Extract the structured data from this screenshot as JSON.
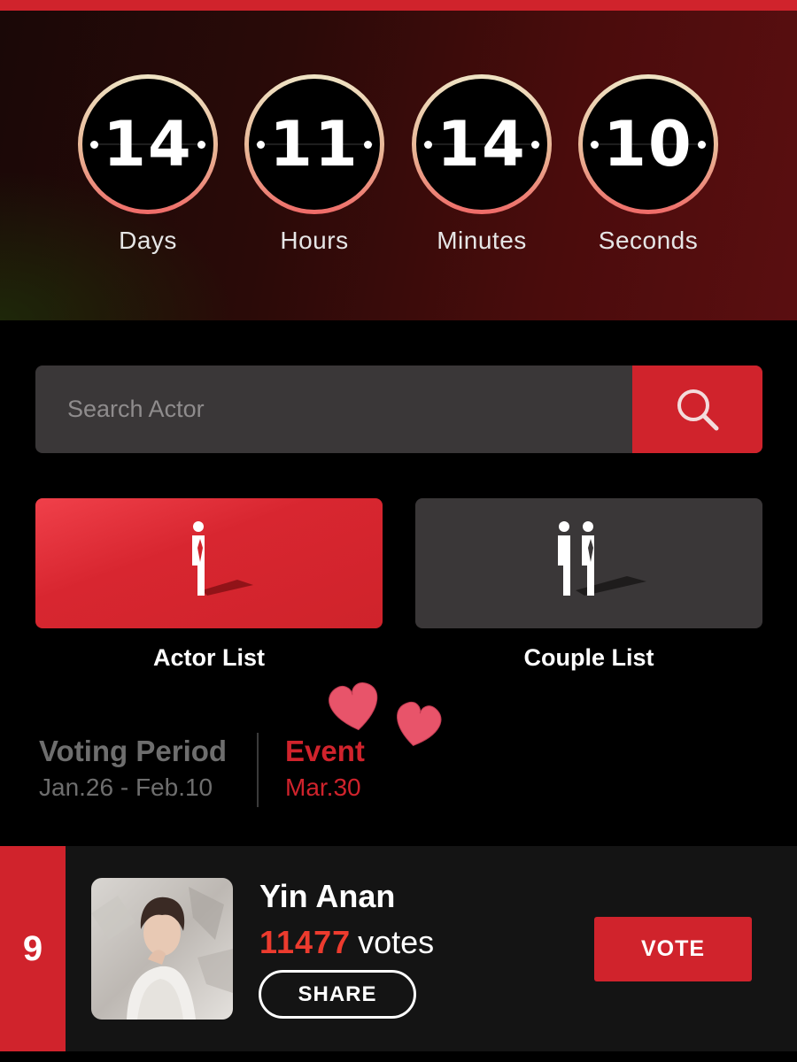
{
  "countdown": {
    "units": [
      {
        "value": "14",
        "label": "Days"
      },
      {
        "value": "11",
        "label": "Hours"
      },
      {
        "value": "14",
        "label": "Minutes"
      },
      {
        "value": "10",
        "label": "Seconds"
      }
    ]
  },
  "search": {
    "placeholder": "Search Actor",
    "icon": "search-icon"
  },
  "lists": {
    "actor_label": "Actor List",
    "actor_icon": "single-figure-icon",
    "couple_label": "Couple List",
    "couple_icon": "couple-figures-icon"
  },
  "voting": {
    "period_title": "Voting Period",
    "period_dates": "Jan.26 - Feb.10",
    "event_title": "Event",
    "event_date": "Mar.30"
  },
  "ranking": {
    "rank": "9",
    "name": "Yin Anan",
    "votes": "11477",
    "votes_suffix": "votes",
    "share_label": "SHARE",
    "vote_label": "VOTE"
  },
  "colors": {
    "accent": "#d0232c",
    "panel": "#3a3738",
    "vote_count": "#ec3b2e",
    "heart": "#e8546a"
  }
}
